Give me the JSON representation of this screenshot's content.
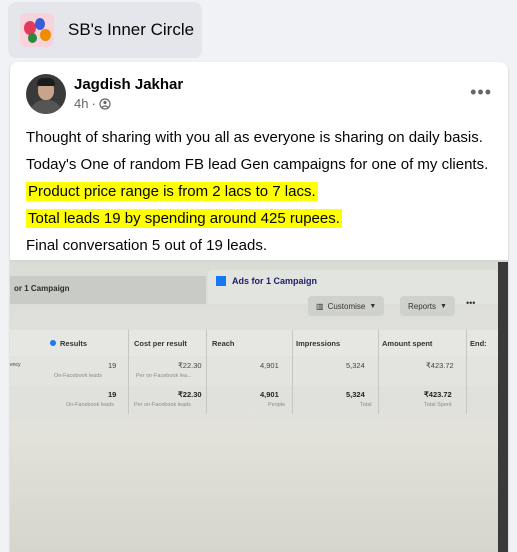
{
  "group": {
    "name": "SB's Inner Circle"
  },
  "post": {
    "author": "Jagdish Jakhar",
    "time": "4h",
    "separator": "·",
    "more": "•••",
    "lines": [
      "Thought of sharing with you all as everyone is sharing on daily basis.",
      "Today's One of random FB lead Gen campaigns for one of my clients.",
      "Product price range is from 2 lacs  to 7 lacs.",
      "Total leads 19 by spending around 425 rupees.",
      "Final conversation 5 out of 19 leads."
    ]
  },
  "screenshot": {
    "tab_left": "or 1 Campaign",
    "tab_right": "Ads for 1 Campaign",
    "customise": "Customise",
    "reports": "Reports",
    "dots": "•••",
    "headers": {
      "results": "Results",
      "cost": "Cost per result",
      "reach": "Reach",
      "impressions": "Impressions",
      "amount": "Amount spent",
      "ends": "End:"
    },
    "row1": {
      "lead": "ency",
      "results": "19",
      "results_sub": "On-Facebook leads",
      "cost": "₹22.30",
      "cost_sub": "Per on-Facebook lea...",
      "reach": "4,901",
      "impressions": "5,324",
      "amount": "₹423.72"
    },
    "row2": {
      "results": "19",
      "results_sub": "On-Facebook leads",
      "cost": "₹22.30",
      "cost_sub": "Per on-Facebook leads",
      "reach": "4,901",
      "reach_sub": "People",
      "impressions": "5,324",
      "impressions_sub": "Total",
      "amount": "₹423.72",
      "amount_sub": "Total Spent"
    }
  },
  "colors": {
    "highlight": "#ffff00",
    "brand": "#1877f2"
  }
}
